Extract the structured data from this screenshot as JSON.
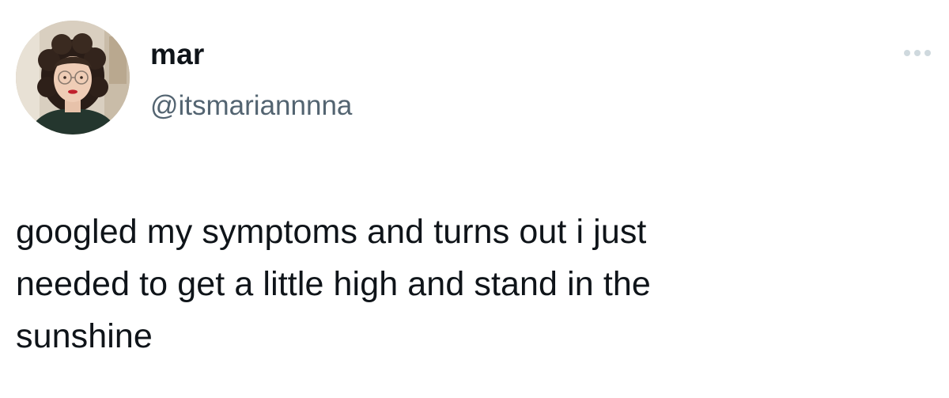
{
  "author": {
    "display_name": "mar",
    "handle": "@itsmariannnna",
    "avatar_icon": "profile-photo"
  },
  "header": {
    "more_icon": "more-horizontal-icon"
  },
  "tweet": {
    "text": "googled my symptoms and turns out i just\nneeded to get a little high and stand in the\nsunshine"
  },
  "colors": {
    "text_primary": "#0f1419",
    "text_secondary": "#536471",
    "more_icon": "#cfd9de",
    "background": "#ffffff"
  }
}
